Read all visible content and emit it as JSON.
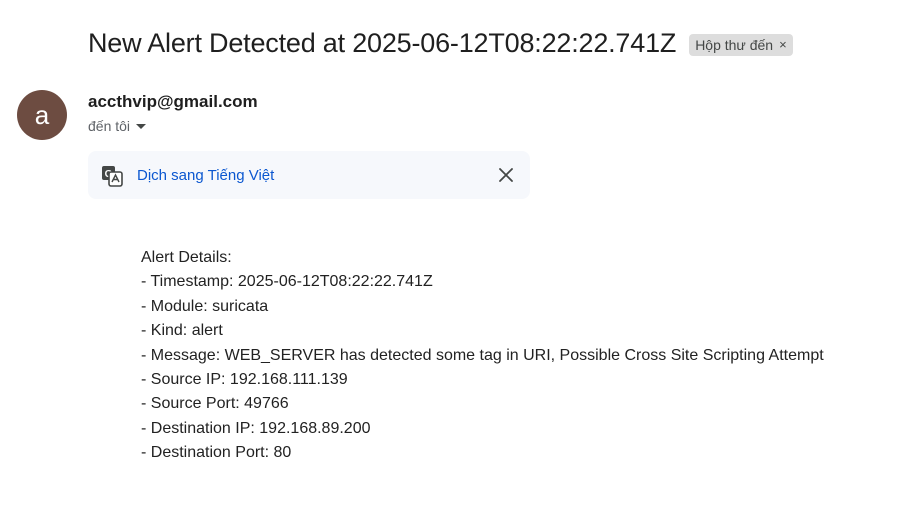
{
  "email": {
    "subject": "New Alert Detected at 2025-06-12T08:22:22.741Z",
    "label": "Hộp thư đến",
    "label_remove": "×",
    "sender": {
      "initial": "a",
      "email": "accthvip@gmail.com",
      "avatar_color": "#6d4c41"
    },
    "recipient_text": "đến tôi",
    "translate": {
      "link_text": "Dịch sang Tiếng Việt",
      "icon": "translate-icon",
      "link_color": "#0b57d0"
    },
    "body_lines": [
      "Alert Details:",
      "- Timestamp: 2025-06-12T08:22:22.741Z",
      "- Module: suricata",
      "- Kind: alert",
      "- Message: WEB_SERVER has detected some tag in URI, Possible Cross Site Scripting Attempt",
      "- Source IP: 192.168.111.139",
      "- Source Port: 49766",
      "- Destination IP: 192.168.89.200",
      "- Destination Port: 80"
    ]
  }
}
